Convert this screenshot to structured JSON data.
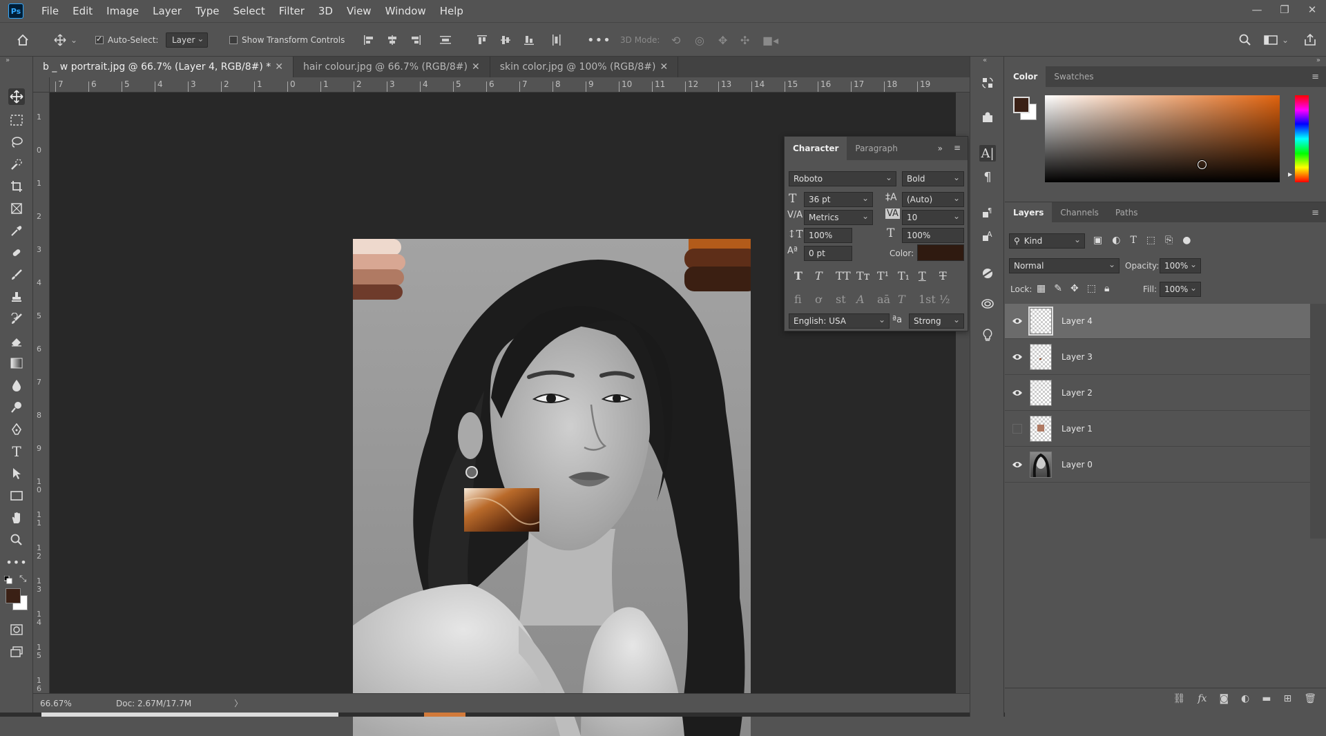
{
  "app": {
    "name": "Adobe Photoshop",
    "logo": "Ps"
  },
  "menu": [
    "File",
    "Edit",
    "Image",
    "Layer",
    "Type",
    "Select",
    "Filter",
    "3D",
    "View",
    "Window",
    "Help"
  ],
  "window_controls": {
    "minimize": "—",
    "restore": "❐",
    "close": "✕"
  },
  "options": {
    "auto_select_label": "Auto-Select:",
    "auto_select_checked": true,
    "auto_select_value": "Layer",
    "transform_label": "Show Transform Controls",
    "transform_checked": false,
    "mode_label": "3D Mode:"
  },
  "tabs": [
    {
      "label": "b _ w portrait.jpg @ 66.7% (Layer 4, RGB/8#) *",
      "close": "✕",
      "active": true
    },
    {
      "label": "hair colour.jpg @ 66.7% (RGB/8#)",
      "close": "✕",
      "active": false
    },
    {
      "label": "skin color.jpg @ 100% (RGB/8#)",
      "close": "✕",
      "active": false
    }
  ],
  "ruler_top": [
    "7",
    "6",
    "5",
    "4",
    "3",
    "2",
    "1",
    "0",
    "1",
    "2",
    "3",
    "4",
    "5",
    "6",
    "7",
    "8",
    "9",
    "10",
    "11",
    "12",
    "13",
    "14",
    "15",
    "16",
    "17",
    "18",
    "19"
  ],
  "ruler_left": [
    "1",
    "0",
    "1",
    "2",
    "3",
    "4",
    "5",
    "6",
    "7",
    "8",
    "9",
    "1\n0",
    "1\n1",
    "1\n2",
    "1\n3",
    "1\n4",
    "1\n5",
    "1\n6"
  ],
  "status": {
    "zoom": "66.67%",
    "doc": "Doc: 2.67M/17.7M",
    "arrow": "〉"
  },
  "color_panel": {
    "tabs": [
      "Color",
      "Swatches"
    ],
    "foreground": "#3a2015",
    "background": "#ffffff",
    "hue_color": "#e0620d"
  },
  "character": {
    "tabs": [
      "Character",
      "Paragraph"
    ],
    "font_family": "Roboto",
    "font_style": "Bold",
    "size": "36 pt",
    "leading": "(Auto)",
    "kerning": "Metrics",
    "tracking": "10",
    "vscale": "100%",
    "hscale": "100%",
    "baseline": "0 pt",
    "color_label": "Color:",
    "color": "#2f1a10",
    "language": "English: USA",
    "aa_label": "ªa",
    "antialias": "Strong",
    "style_buttons": [
      "T",
      "T",
      "TT",
      "Tт",
      "T¹",
      "T₁",
      "T",
      "T"
    ],
    "opentype_buttons": [
      "fi",
      "ơ",
      "st",
      "A",
      "aā",
      "T",
      "1st",
      "½"
    ]
  },
  "layers_panel": {
    "tabs": [
      "Layers",
      "Channels",
      "Paths"
    ],
    "filter_value": "Kind",
    "blend_mode": "Normal",
    "opacity_label": "Opacity:",
    "opacity": "100%",
    "lock_label": "Lock:",
    "fill_label": "Fill:",
    "fill": "100%",
    "layers": [
      {
        "name": "Layer 4",
        "visible": true,
        "selected": true
      },
      {
        "name": "Layer 3",
        "visible": true,
        "selected": false
      },
      {
        "name": "Layer 2",
        "visible": true,
        "selected": false
      },
      {
        "name": "Layer 1",
        "visible": false,
        "selected": false
      },
      {
        "name": "Layer 0",
        "visible": true,
        "selected": false
      }
    ],
    "footer_icons": [
      "link-icon",
      "fx-icon",
      "mask-icon",
      "adjustment-icon",
      "folder-icon",
      "new-layer-icon",
      "trash-icon"
    ]
  },
  "swatch_colors": {
    "skin": [
      "#eed9cd",
      "#d8a793",
      "#b07a63",
      "#6e3b2b"
    ],
    "hair": [
      "#b35b1a",
      "#5e2e18",
      "#3b1f12"
    ]
  }
}
